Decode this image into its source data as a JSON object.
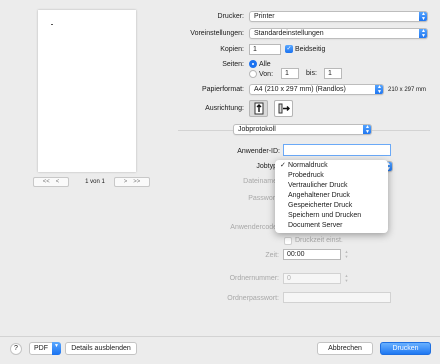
{
  "preview": {
    "page_indicator": "1 von 1",
    "first_icon": "first-page-icon",
    "prev_icon": "previous-page-icon",
    "next_icon": "next-page-icon",
    "last_icon": "last-page-icon"
  },
  "printer": {
    "label": "Drucker:",
    "value": "Printer"
  },
  "presets": {
    "label": "Voreinstellungen:",
    "value": "Standardeinstellungen"
  },
  "copies": {
    "label": "Kopien:",
    "value": "1",
    "duplex_label": "Beidseitig",
    "duplex_checked": true
  },
  "pages": {
    "label": "Seiten:",
    "all_label": "Alle",
    "from_label": "Von:",
    "from_value": "1",
    "to_label": "bis:",
    "to_value": "1"
  },
  "paper": {
    "label": "Papierformat:",
    "value": "A4 (210 x 297 mm) (Randlos)",
    "dimensions": "210 x 297 mm"
  },
  "orientation": {
    "label": "Ausrichtung:",
    "portrait_icon": "portrait-orientation-icon",
    "landscape_icon": "landscape-orientation-icon"
  },
  "section": {
    "value": "Jobprotokoll"
  },
  "job": {
    "user_id_label": "Anwender-ID:",
    "user_id_value": "",
    "type_label": "Jobtyp",
    "type_options": [
      "Normaldruck",
      "Probedruck",
      "Vertraulicher Druck",
      "Angehaltener Druck",
      "Gespeicherter Druck",
      "Speichern und Drucken",
      "Document Server"
    ],
    "type_selected": "Normaldruck",
    "filename_label": "Dateiname",
    "password_label": "Passwort",
    "user_code_label": "Anwendercode",
    "print_time_label": "Druckzeit einst.",
    "time_label": "Zeit:",
    "time_value": "00:00",
    "folder_number_label": "Ordnernummer:",
    "folder_number_value": "0",
    "folder_password_label": "Ordnerpasswort:"
  },
  "footer": {
    "help_label": "?",
    "pdf_label": "PDF",
    "hide_details_label": "Details ausblenden",
    "cancel_label": "Abbrechen",
    "print_label": "Drucken"
  },
  "colors": {
    "accent": "#1a72f0",
    "background": "#ececec"
  }
}
